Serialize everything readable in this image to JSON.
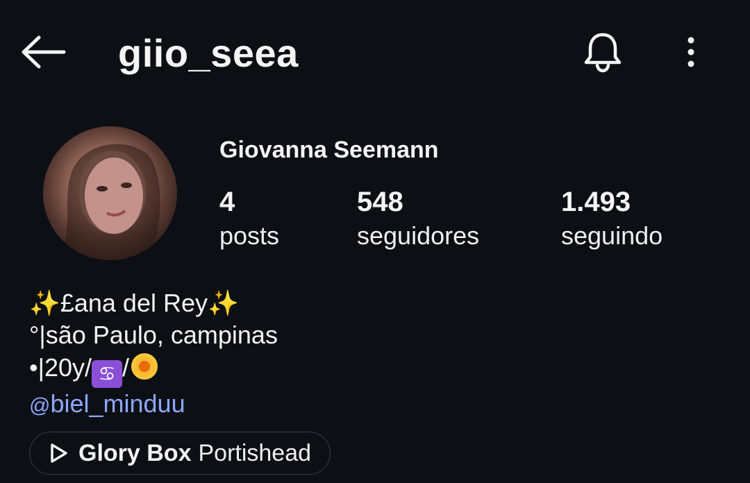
{
  "header": {
    "username": "giio_seea",
    "icons": [
      "back-arrow-icon",
      "bell-icon",
      "more-vert-icon"
    ]
  },
  "profile": {
    "full_name": "Giovanna Seemann",
    "stats": {
      "posts": {
        "value": "4",
        "label": "posts"
      },
      "followers": {
        "value": "548",
        "label": "seguidores"
      },
      "following": {
        "value": "1.493",
        "label": "seguindo"
      }
    }
  },
  "bio": {
    "line1_sparkle_left": "✨",
    "line1_text": "£ana del Rey",
    "line1_sparkle_right": "✨",
    "line2": "°|são Paulo, campinas",
    "line3_prefix": "•|20y/",
    "line3_sign": "♋",
    "line3_sep": "/",
    "threads_icon": "@",
    "threads_handle": "biel_minduu"
  },
  "music": {
    "song": "Glory Box",
    "artist": "Portishead"
  },
  "colors": {
    "background": "#0c0f14",
    "link": "#8ea7ff",
    "sign_badge": "#8a4fd6"
  }
}
